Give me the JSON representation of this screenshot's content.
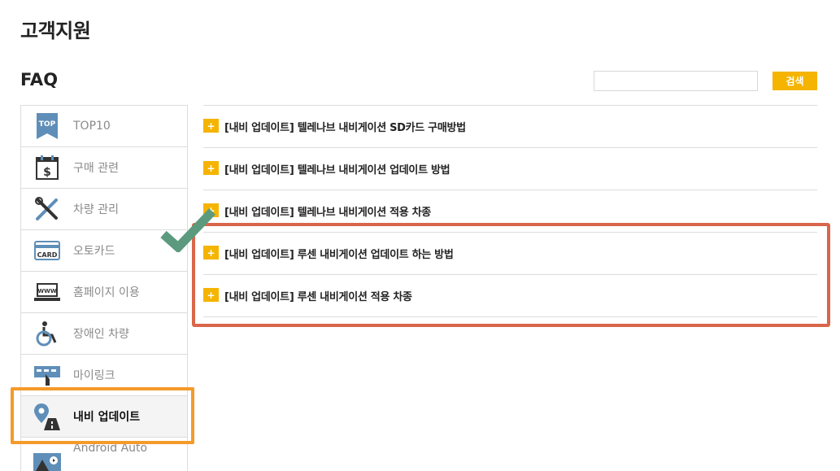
{
  "page": {
    "title": "고객지원",
    "section_title": "FAQ"
  },
  "search": {
    "value": "",
    "placeholder": "",
    "button_label": "검색"
  },
  "sidebar": {
    "items": [
      {
        "label": "TOP10",
        "icon": "top10-icon"
      },
      {
        "label": "구매 관련",
        "icon": "purchase-calendar-icon"
      },
      {
        "label": "차량 관리",
        "icon": "tools-icon"
      },
      {
        "label": "오토카드",
        "icon": "card-icon"
      },
      {
        "label": "홈페이지 이용",
        "icon": "www-laptop-icon"
      },
      {
        "label": "장애인 차량",
        "icon": "wheelchair-icon"
      },
      {
        "label": "마이링크",
        "icon": "mylink-icon"
      },
      {
        "label": "내비 업데이트",
        "icon": "navi-pin-icon",
        "active": true
      },
      {
        "label": "Android Auto",
        "icon": "android-auto-icon"
      }
    ]
  },
  "faq": {
    "expand_symbol": "+",
    "items": [
      {
        "text": "[내비 업데이트] 텔레나브 내비게이션 SD카드 구매방법"
      },
      {
        "text": "[내비 업데이트] 텔레나브 내비게이션 업데이트 방법"
      },
      {
        "text": "[내비 업데이트] 텔레나브 내비게이션 적용 차종"
      },
      {
        "text": "[내비 업데이트] 루센 내비게이션 업데이트 하는 방법"
      },
      {
        "text": "[내비 업데이트] 루센 내비게이션 적용 차종"
      }
    ]
  },
  "colors": {
    "accent": "#f5b400",
    "highlight_orange": "#f59a2a",
    "highlight_red": "#d9664a",
    "check_green": "#5b9a7e"
  }
}
